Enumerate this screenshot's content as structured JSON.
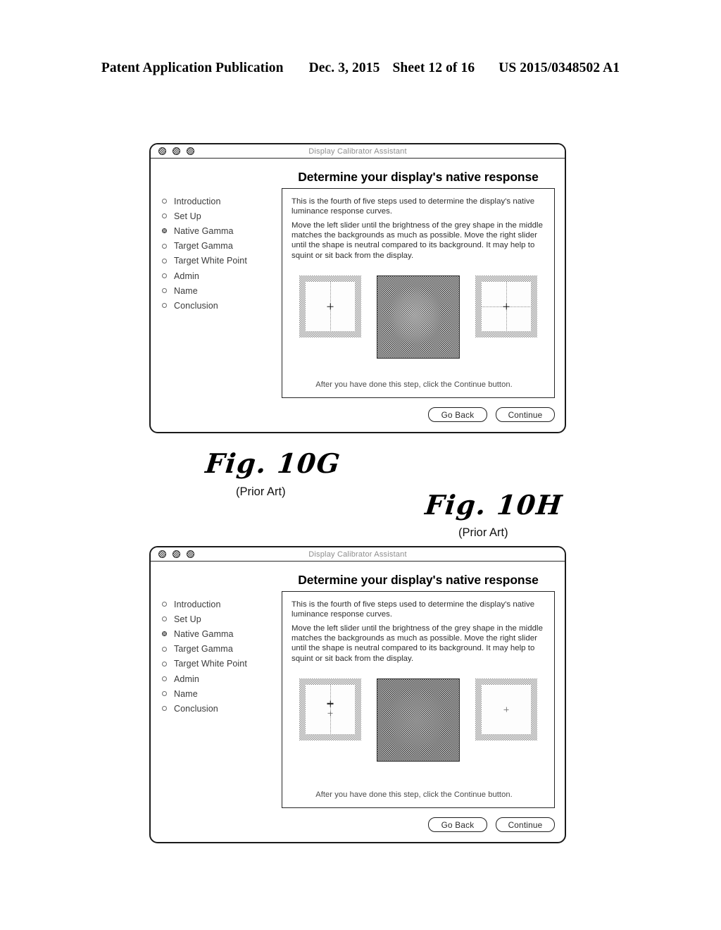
{
  "patent_header": {
    "publication": "Patent Application Publication",
    "date": "Dec. 3, 2015",
    "sheet": "Sheet 12 of 16",
    "number": "US 2015/0348502 A1"
  },
  "window": {
    "title": "Display Calibrator Assistant",
    "page_title": "Determine your display's native response",
    "traffic_lights": [
      "close-light",
      "minimize-light",
      "zoom-light"
    ],
    "sidebar": [
      {
        "label": "Introduction",
        "active": false
      },
      {
        "label": "Set Up",
        "active": false
      },
      {
        "label": "Native Gamma",
        "active": true
      },
      {
        "label": "Target Gamma",
        "active": false
      },
      {
        "label": "Target White Point",
        "active": false
      },
      {
        "label": "Admin",
        "active": false
      },
      {
        "label": "Name",
        "active": false
      },
      {
        "label": "Conclusion",
        "active": false
      }
    ],
    "paragraph_1": "This is the fourth of five steps used to determine the display's native luminance response curves.",
    "paragraph_2": "Move the left slider until the brightness of the grey shape in the middle matches the backgrounds as much as possible. Move the right slider until the shape is neutral compared to its background. It may help to squint or sit back from the display.",
    "after_text": "After you have done this step, click the Continue button.",
    "buttons": {
      "go_back": "Go Back",
      "continue": "Continue"
    }
  },
  "figures": [
    {
      "caption": "Fig. 10G",
      "note": "(Prior Art)"
    },
    {
      "caption": "Fig. 10H",
      "note": "(Prior Art)"
    }
  ],
  "colors": {
    "frame_border": "#1a1a1a",
    "title_text": "#8d8d8d",
    "dark_patch": "#3b3b3b",
    "light_patch_frame": "#909090"
  }
}
